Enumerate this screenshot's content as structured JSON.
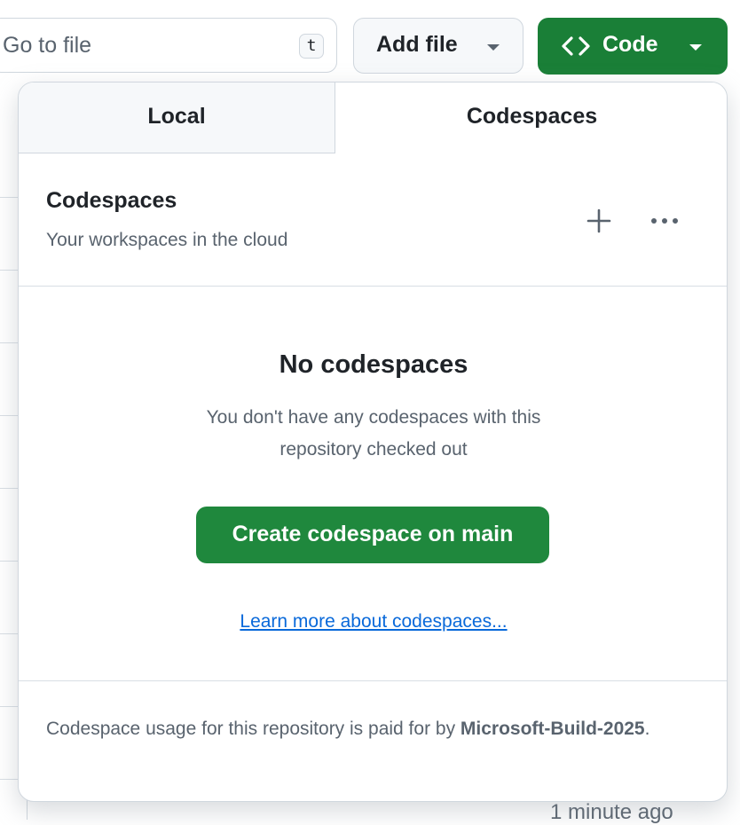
{
  "toolbar": {
    "goto_placeholder": "Go to file",
    "goto_shortcut": "t",
    "add_file_label": "Add file",
    "code_label": "Code"
  },
  "background": {
    "timestamp": "1 minute ago"
  },
  "dropdown": {
    "tabs": [
      {
        "label": "Local",
        "selected": false
      },
      {
        "label": "Codespaces",
        "selected": true
      }
    ],
    "header": {
      "title": "Codespaces",
      "subtitle": "Your workspaces in the cloud",
      "actions": [
        "plus-icon",
        "kebab-horizontal-icon"
      ]
    },
    "empty_state": {
      "title": "No codespaces",
      "description": "You don't have any codespaces with this repository checked out",
      "create_button": "Create codespace on main",
      "learn_more": "Learn more about codespaces..."
    },
    "footer": {
      "text_before": "Codespace usage for this repository is paid for by ",
      "owner": "Microsoft-Build-2025",
      "text_after": "."
    }
  },
  "colors": {
    "primary_green": "#1f883d",
    "code_button_green": "#1a7f37",
    "link_blue": "#0969da",
    "muted_text": "#59636e",
    "border": "#d0d7de"
  }
}
